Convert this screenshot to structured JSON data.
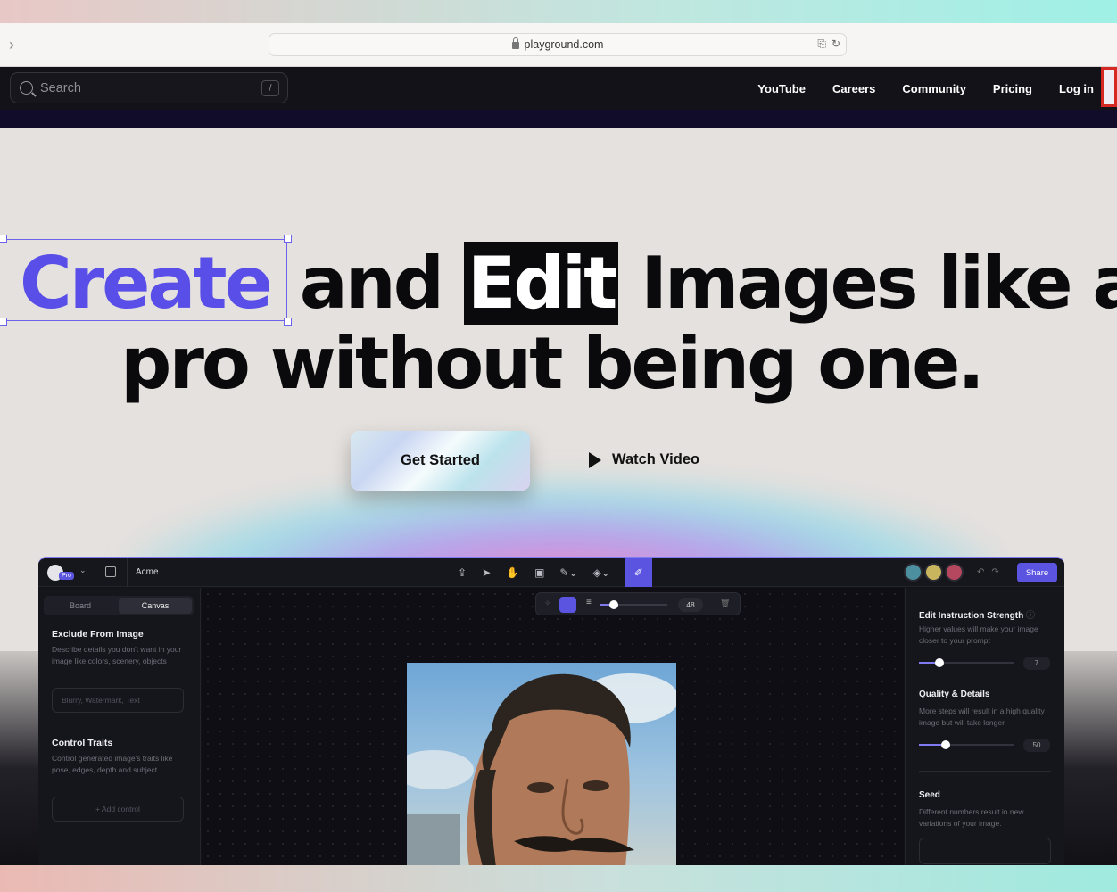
{
  "browser": {
    "url": "playground.com"
  },
  "nav": {
    "search_placeholder": "Search",
    "search_shortcut": "/",
    "links": [
      "YouTube",
      "Careers",
      "Community",
      "Pricing",
      "Log in"
    ]
  },
  "hero": {
    "word_create": "Create",
    "word_and": "and",
    "word_edit": "Edit",
    "word_rest": "Images like a",
    "line2": "pro without being one.",
    "get_started": "Get Started",
    "watch_video": "Watch Video"
  },
  "app": {
    "badge": "Pro",
    "project": "Acme",
    "share": "Share",
    "tabs": [
      "Board",
      "Canvas"
    ],
    "active_tab": "Canvas",
    "brush_size": "48",
    "left": {
      "exclude_title": "Exclude From Image",
      "exclude_desc": "Describe details you don't want in your image like colors, scenery, objects",
      "exclude_placeholder": "Blurry, Watermark, Text",
      "control_title": "Control Traits",
      "control_desc": "Control generated image's traits like pose, edges, depth and subject.",
      "add_control": "+ Add control"
    },
    "right": {
      "strength_title": "Edit Instruction Strength",
      "strength_desc": "Higher values will make your image closer to your prompt",
      "strength_value": "7",
      "strength_level": 0.22,
      "quality_title": "Quality & Details",
      "quality_desc": "More steps will result in a high quality image but will take longer.",
      "quality_value": "50",
      "quality_level": 0.28,
      "seed_title": "Seed",
      "seed_desc": "Different numbers result in new variations of your image."
    }
  },
  "colors": {
    "accent": "#5b54e0",
    "create": "#5a4ee8",
    "nav_bg": "#121218",
    "highlight_border": "#d42a23"
  }
}
